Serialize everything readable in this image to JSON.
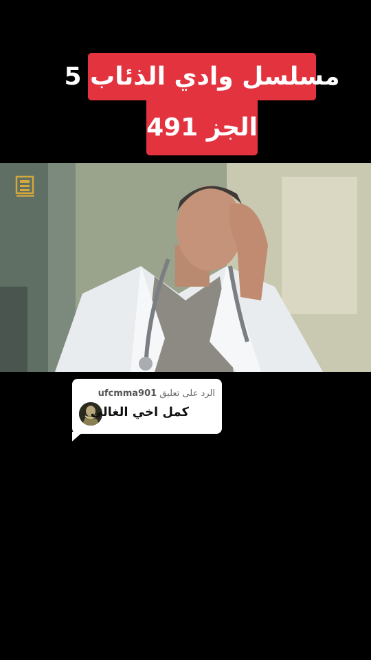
{
  "title": {
    "line1": "مسلسل وادي الذئاب 5",
    "line2": "الجز 491",
    "background": "#e2333f",
    "text_color": "#ffffff"
  },
  "video": {
    "watermark_icon": "production-logo-icon"
  },
  "reply_comment": {
    "header_prefix": "الرد على تعليق",
    "username": "ufcmma901",
    "text": "كمل اخي الغالي",
    "avatar_icon": "user-avatar-icon"
  }
}
